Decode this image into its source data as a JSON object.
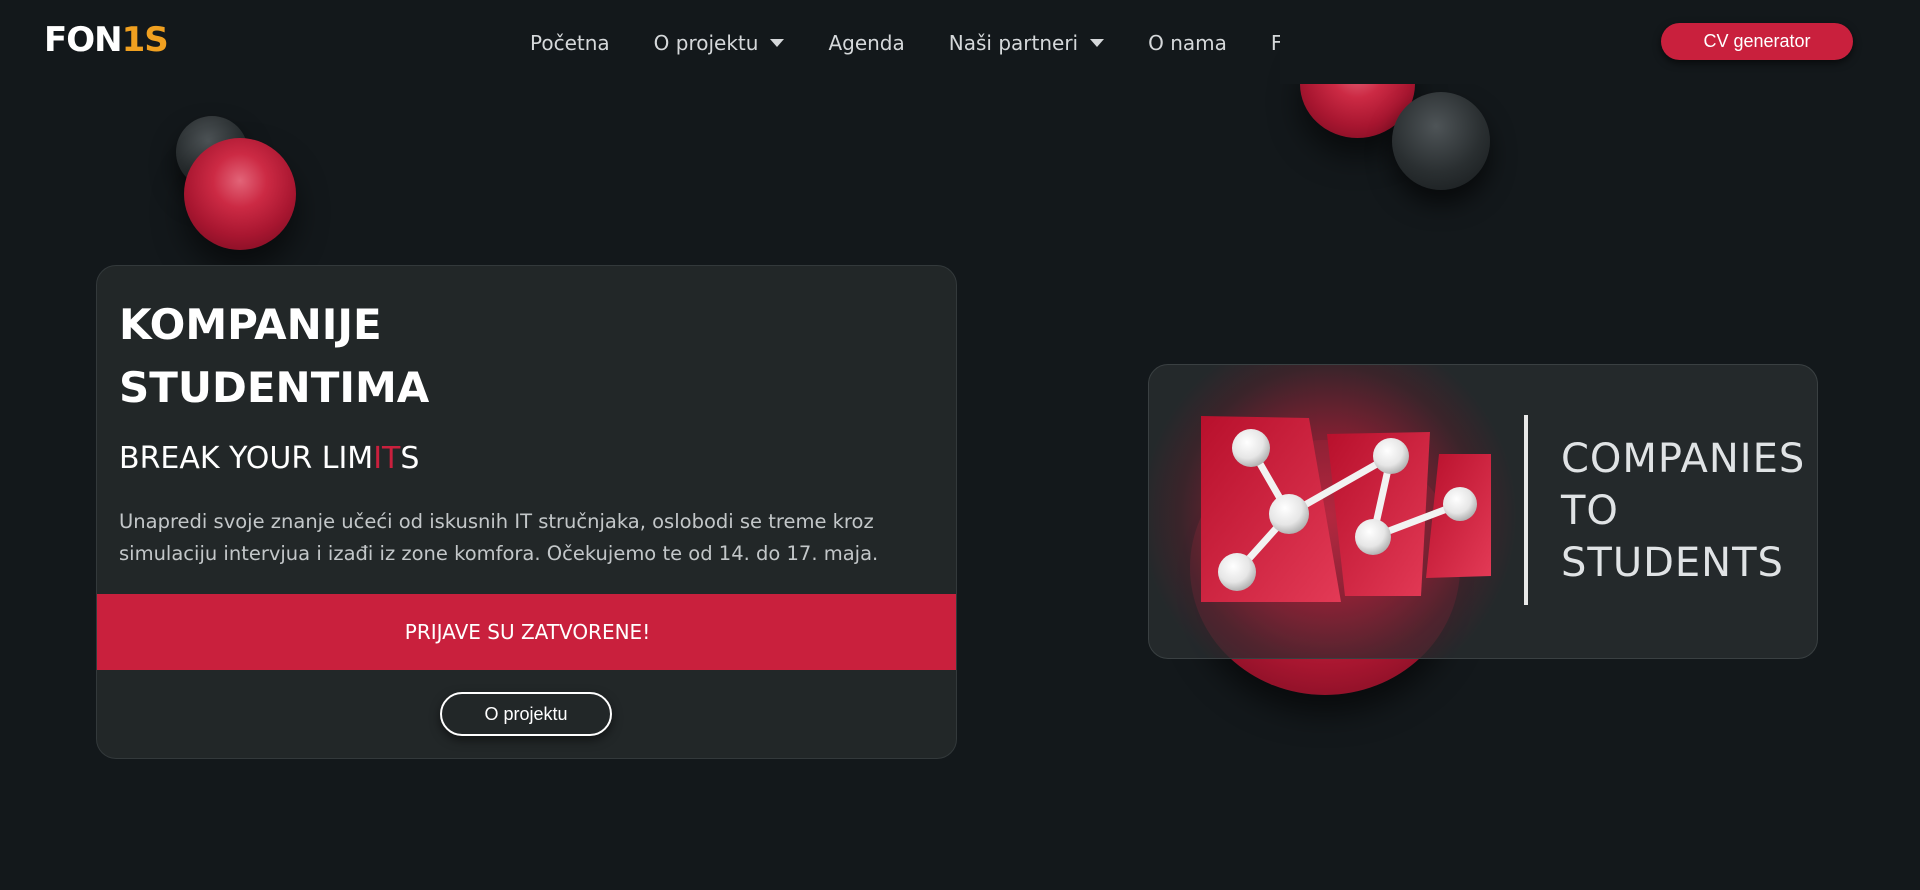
{
  "logo": {
    "part1": "FON",
    "part2": "IS",
    "part1_prefix": "FON",
    "part2_suffix": "1S"
  },
  "nav": {
    "items": [
      {
        "label": "Početna",
        "has_dropdown": false
      },
      {
        "label": "O projektu",
        "has_dropdown": true
      },
      {
        "label": "Agenda",
        "has_dropdown": false
      },
      {
        "label": "Naši partneri",
        "has_dropdown": true
      },
      {
        "label": "O nama",
        "has_dropdown": false
      },
      {
        "label": "FAQ",
        "has_dropdown": false
      }
    ],
    "cta_label": "CV generator"
  },
  "hero": {
    "title_line1": "KOMPANIJE",
    "title_line2": "STUDENTIMA",
    "subtitle_pre": "BREAK YOUR LIM",
    "subtitle_accent": "IT",
    "subtitle_post": "S",
    "description": "Unapredi svoje znanje učeći od iskusnih IT stručnjaka, oslobodi se treme kroz simulaciju intervjua i izađi iz zone komfora. Očekujemo te od 14. do 17. maja.",
    "status_banner": "PRIJAVE SU ZATVORENE!",
    "about_button": "O projektu"
  },
  "brand": {
    "line1": "COMPANIES",
    "line2": "TO",
    "line3": "STUDENTS"
  },
  "colors": {
    "accent": "#c9203d",
    "background": "#13181b",
    "card": "#222728",
    "logo_orange": "#f0a020"
  }
}
